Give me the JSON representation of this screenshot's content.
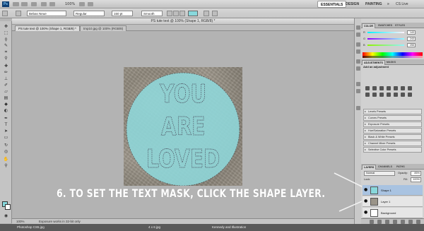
{
  "app": {
    "logo": "Ps",
    "zoom": "100%"
  },
  "workspaces": {
    "essentials": "ESSENTIALS",
    "design": "DESIGN",
    "painting": "PAINTING",
    "more": "»",
    "cs_live": "CS Live"
  },
  "options": {
    "font_family": "Bebas Neue",
    "font_style": "Regular",
    "font_size": "150 pt",
    "antialias": "Smooth",
    "text_color": "#88d8dc"
  },
  "document": {
    "title": "PS tute text @ 100% (Shape 1, RGB/8) *",
    "tabs": [
      {
        "label": "PS tute text @ 100% (Shape 1, RGB/8) *"
      },
      {
        "label": "tmp10.jpg @ 100% (RGB/8)"
      }
    ],
    "canvas_text": [
      "YOU",
      "ARE",
      "LOVED"
    ],
    "circle_color": "#8fd6d8",
    "zoom": "100%",
    "status_message": "Exposure works in 32-bit only"
  },
  "caption": "6. TO SET THE TEXT MASK, CLICK THE SHAPE LAYER.",
  "color_panel": {
    "tabs": [
      "COLOR",
      "SWATCHES",
      "STYLES"
    ],
    "channels": [
      {
        "label": "R",
        "value": "143"
      },
      {
        "label": "G",
        "value": "243"
      },
      {
        "label": "B",
        "value": "255"
      }
    ]
  },
  "adjustments_panel": {
    "tabs": [
      "ADJUSTMENTS",
      "MASKS"
    ],
    "title": "Add an adjustment",
    "presets": [
      "Levels Presets",
      "Curves Presets",
      "Exposure Presets",
      "Hue/Saturation Presets",
      "Black & White Presets",
      "Channel Mixer Presets",
      "Selective Color Presets"
    ]
  },
  "layers_panel": {
    "tabs": [
      "LAYERS",
      "CHANNELS",
      "PATHS"
    ],
    "blend_mode": "Normal",
    "opacity_label": "Opacity:",
    "opacity": "85%",
    "lock_label": "Lock:",
    "fill_label": "Fill:",
    "fill": "100%",
    "layers": [
      {
        "name": "Shape 1",
        "selected": true,
        "thumb_color": "#88d8dc"
      },
      {
        "name": "Layer 1",
        "selected": false,
        "thumb_color": "#9a9489"
      },
      {
        "name": "Background",
        "selected": false,
        "thumb_color": "#ffffff"
      }
    ]
  },
  "taskbar": {
    "items": [
      "Photoshop CS5.jpg",
      "4 x 6 jpg",
      "Kennedy and Illustration"
    ]
  }
}
